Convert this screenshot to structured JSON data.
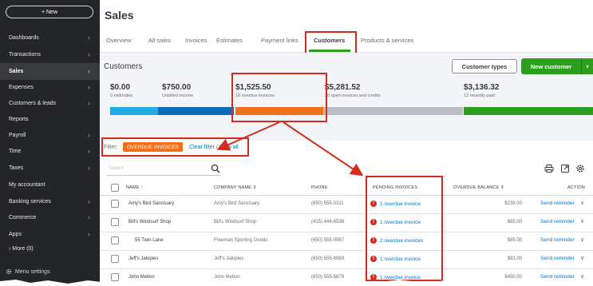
{
  "sidebar": {
    "new_label": "+ New",
    "items": [
      {
        "label": "Dashboards",
        "chevron": true
      },
      {
        "label": "Transactions",
        "chevron": true
      },
      {
        "label": "Sales",
        "chevron": true
      },
      {
        "label": "Expenses",
        "chevron": true
      },
      {
        "label": "Customers & leads",
        "chevron": true
      },
      {
        "label": "Reports",
        "chevron": false
      },
      {
        "label": "Payroll",
        "chevron": true
      },
      {
        "label": "Time",
        "chevron": true
      },
      {
        "label": "Taxes",
        "chevron": true
      },
      {
        "label": "My accountant",
        "chevron": false
      },
      {
        "label": "Banking services",
        "chevron": true
      },
      {
        "label": "Commerce",
        "chevron": true
      },
      {
        "label": "Apps",
        "chevron": true
      },
      {
        "label": "› More (0)",
        "chevron": false
      }
    ],
    "menu_settings": "Menu settings",
    "chevron_glyph": "›"
  },
  "header": {
    "title": "Sales",
    "tabs": [
      "Overview",
      "All sales",
      "Invoices",
      "Estimates",
      "Payment links",
      "Customers",
      "Products & services"
    ],
    "active_tab": "Customers"
  },
  "customers": {
    "title": "Customers",
    "customer_types_label": "Customer types",
    "new_customer_label": "New customer",
    "new_customer_arrow": "∨",
    "stats": [
      {
        "amount": "$0.00",
        "label": "0 estimates"
      },
      {
        "amount": "$750.00",
        "label": "Unbilled income"
      },
      {
        "amount": "$1,525.50",
        "label": "10 overdue invoices"
      },
      {
        "amount": "$5,281.52",
        "label": "20 open invoices and credits"
      },
      {
        "amount": "$3,136.32",
        "label": "12 recently paid"
      }
    ],
    "bar_colors": [
      "#21abe2",
      "#0a6cb8",
      "#f2711c",
      "#babec5",
      "#2ca01c"
    ],
    "collapse_glyph": "^"
  },
  "filter": {
    "label": "Filter:",
    "chip": "OVERDUE INVOICES",
    "link": "Clear filter / View all"
  },
  "search": {
    "placeholder": "Search"
  },
  "table": {
    "headers": {
      "name": "NAME ↑",
      "company": "COMPANY NAME ⇕",
      "phone": "PHONE",
      "pending": "PENDING INVOICES",
      "overdue": "OVERDUE BALANCE ⇕",
      "action": "ACTION"
    },
    "rows": [
      {
        "name": "Amy's Bird Sanctuary",
        "company": "Amy's Bird Sanctuary",
        "phone": "(650) 555-3311",
        "pending": "1 overdue invoice",
        "balance": "$239.00",
        "action": "Send reminder"
      },
      {
        "name": "Bill's Windsurf Shop",
        "company": "Bill's Windsurf Shop",
        "phone": "(415) 444-6538",
        "pending": "1 overdue invoice",
        "balance": "$85.00",
        "action": "Send reminder"
      },
      {
        "name": "55 Twin Lane",
        "company": "Freeman Sporting Goods",
        "phone": "(650) 555-0987",
        "pending": "2 overdue invoices",
        "balance": "$85.00",
        "action": "Send reminder"
      },
      {
        "name": "Jeff's Jalopies",
        "company": "Jeff's Jalopies",
        "phone": "(650) 555-8989",
        "pending": "1 overdue invoice",
        "balance": "$81.00",
        "action": "Send reminder"
      },
      {
        "name": "John Melton",
        "company": "John Melton",
        "phone": "(650) 555-5879",
        "pending": "1 overdue invoice",
        "balance": "$450.00",
        "action": "Send reminder"
      }
    ],
    "alert_glyph": "!",
    "dropdown_glyph": "∨"
  },
  "colors": {
    "accent_green": "#2ca01c",
    "highlight_red": "#d52b1e",
    "link_blue": "#0077c5",
    "chip_orange": "#f2711c"
  }
}
